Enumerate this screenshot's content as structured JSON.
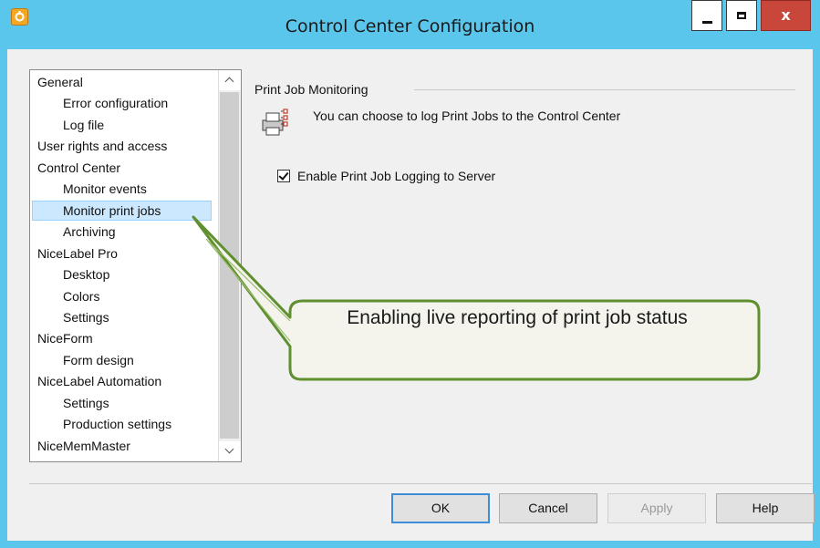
{
  "window": {
    "title": "Control Center Configuration",
    "close_glyph": "x"
  },
  "nav": {
    "items": [
      {
        "label": "General",
        "level": 0
      },
      {
        "label": "Error configuration",
        "level": 1
      },
      {
        "label": "Log file",
        "level": 1
      },
      {
        "label": "User rights and access",
        "level": 0
      },
      {
        "label": "Control Center",
        "level": 0
      },
      {
        "label": "Monitor events",
        "level": 1
      },
      {
        "label": "Monitor print jobs",
        "level": 1,
        "selected": true
      },
      {
        "label": "Archiving",
        "level": 1
      },
      {
        "label": "NiceLabel Pro",
        "level": 0
      },
      {
        "label": "Desktop",
        "level": 1
      },
      {
        "label": "Colors",
        "level": 1
      },
      {
        "label": "Settings",
        "level": 1
      },
      {
        "label": "NiceForm",
        "level": 0
      },
      {
        "label": "Form design",
        "level": 1
      },
      {
        "label": "NiceLabel Automation",
        "level": 0
      },
      {
        "label": "Settings",
        "level": 1
      },
      {
        "label": "Production settings",
        "level": 1
      },
      {
        "label": "NiceMemMaster",
        "level": 0
      }
    ]
  },
  "panel": {
    "section_title": "Print Job Monitoring",
    "info_text": "You can choose to log Print Jobs to the Control Center",
    "checkbox_label": "Enable Print Job Logging to Server",
    "checkbox_checked": true
  },
  "callout": {
    "text": "Enabling live reporting of print job status"
  },
  "buttons": {
    "ok": "OK",
    "cancel": "Cancel",
    "apply": "Apply",
    "help": "Help"
  },
  "colors": {
    "title_bar": "#5bc6ec",
    "close_button": "#c8463a",
    "selection": "#cce8ff",
    "callout_border": "#5f8f2f"
  }
}
